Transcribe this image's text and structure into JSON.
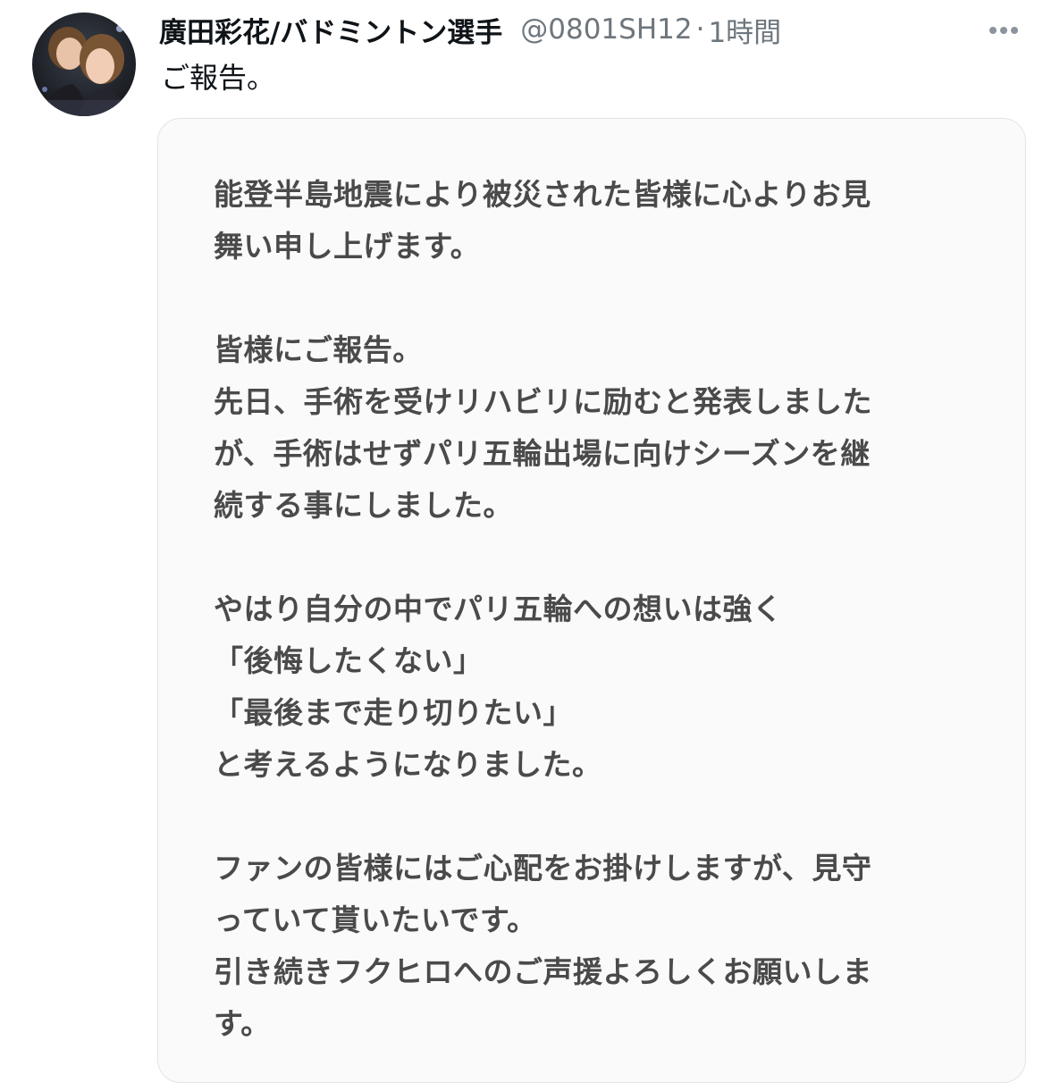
{
  "tweet": {
    "display_name": "廣田彩花/バドミントン選手",
    "handle": "@0801SH12",
    "separator": "·",
    "time": "1時間",
    "text": "ご報告。",
    "more_icon": "more-horizontal-icon"
  },
  "statement": {
    "line_1": "能登半島地震により被災された皆様に心よりお見",
    "line_2": "舞い申し上げます。",
    "line_3": "皆様にご報告。",
    "line_4": "先日、手術を受けリハビリに励むと発表しました",
    "line_5": "が、手術はせずパリ五輪出場に向けシーズンを継",
    "line_6": "続する事にしました。",
    "line_7": "やはり自分の中でパリ五輪への想いは強く",
    "line_8": "「後悔したくない」",
    "line_9": "「最後まで走り切りたい」",
    "line_10": "と考えるようになりました。",
    "line_11": "ファンの皆様にはご心配をお掛けしますが、見守",
    "line_12": "っていて貰いたいです。",
    "line_13": "引き続きフクヒロへのご声援よろしくお願いしま",
    "line_14": "す。"
  },
  "colors": {
    "name": "#0f1419",
    "muted": "#6e767d",
    "statement_text": "#4a4a4a",
    "card_background": "#fafafa"
  }
}
